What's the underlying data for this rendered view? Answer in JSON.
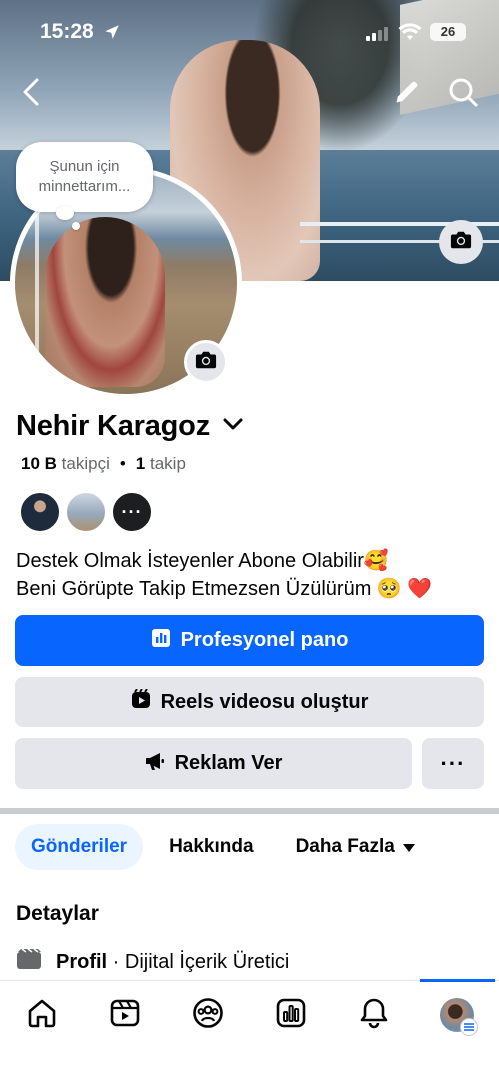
{
  "status_bar": {
    "time": "15:28",
    "battery": "26"
  },
  "cover": {
    "icons": [
      "back-arrow-icon",
      "pencil-icon",
      "search-icon",
      "camera-icon"
    ]
  },
  "avatar": {
    "note_bubble": "Şunun için minnettarım..."
  },
  "profile": {
    "name": "Nehir Karagoz",
    "followers_count": "10 B",
    "followers_label": "takipçi",
    "following_count": "1",
    "following_label": "takip",
    "more_friends": "···"
  },
  "bio": {
    "line1": "Destek Olmak İsteyenler Abone Olabilir🥰",
    "line2": "Beni Görüpte Takip Etmezsen Üzülürüm 🥺 ❤️"
  },
  "buttons": {
    "professional_dashboard": "Profesyonel pano",
    "create_reel": "Reels videosu oluştur",
    "advertise": "Reklam Ver",
    "more": "···"
  },
  "tabs": [
    {
      "label": "Gönderiler",
      "active": true
    },
    {
      "label": "Hakkında",
      "active": false
    },
    {
      "label": "Daha Fazla",
      "active": false
    }
  ],
  "details": {
    "title": "Detaylar",
    "profile_label": "Profil",
    "profile_value": " · Dijital İçerik Üretici"
  },
  "bottom_nav": {
    "items": [
      "home-icon",
      "video-icon",
      "groups-icon",
      "dashboard-icon",
      "notifications-icon",
      "profile-menu-icon"
    ],
    "active_index": 5
  },
  "colors": {
    "accent": "#0866ff",
    "button_gray": "#e4e6eb",
    "active_tab_bg": "#ebf5ff"
  }
}
